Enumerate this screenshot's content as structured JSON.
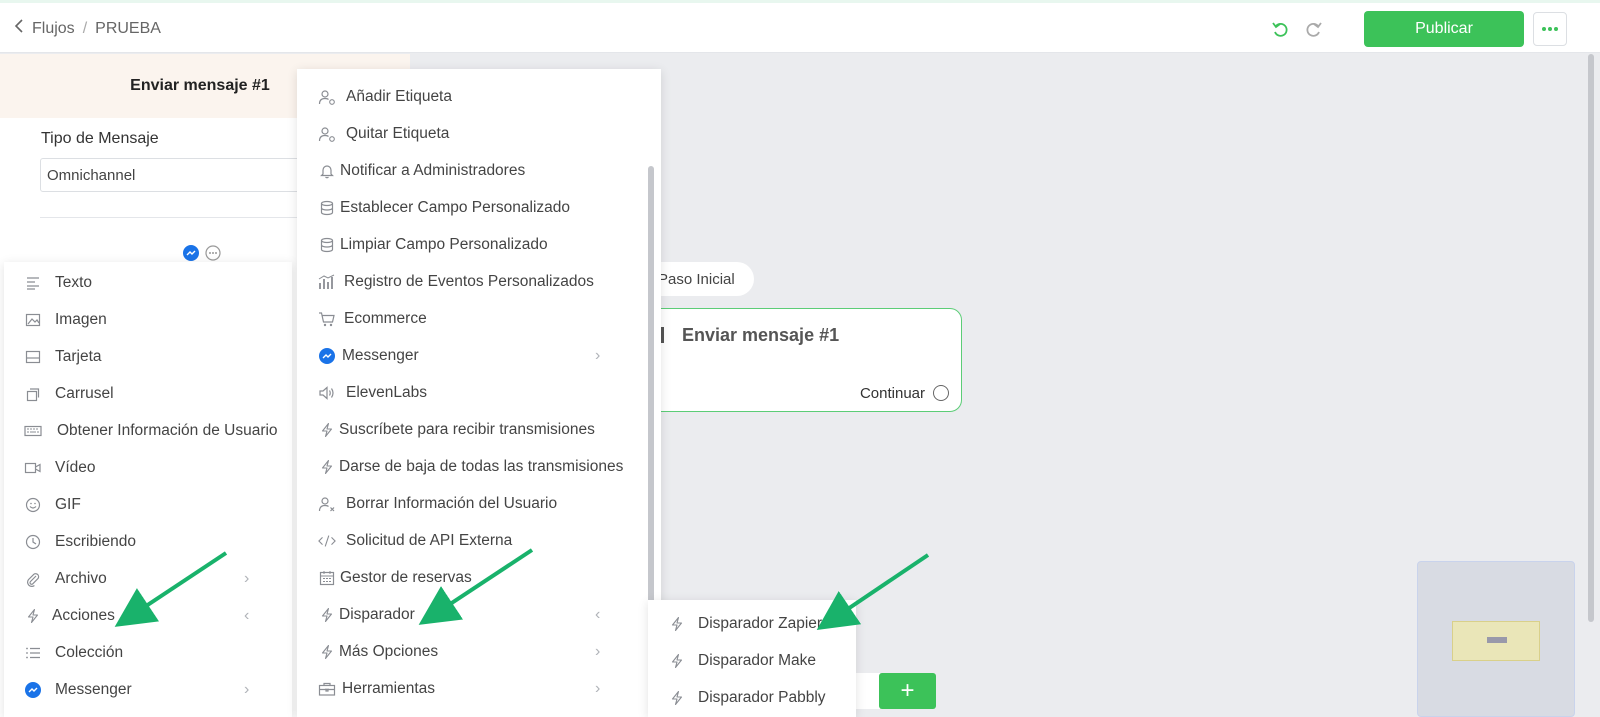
{
  "header": {
    "back_label": "Flujos",
    "separator": "/",
    "flow_name": "PRUEBA",
    "publish_label": "Publicar",
    "accent_color": "#3cc259"
  },
  "panel": {
    "title": "Enviar mensaje #1",
    "tipo_label": "Tipo de Mensaje",
    "tipo_value": "Omnichannel"
  },
  "content_menu": {
    "items": [
      {
        "label": "Texto",
        "icon": "text-lines-icon"
      },
      {
        "label": "Imagen",
        "icon": "image-icon"
      },
      {
        "label": "Tarjeta",
        "icon": "card-icon"
      },
      {
        "label": "Carrusel",
        "icon": "carousel-icon"
      },
      {
        "label": "Obtener Información de Usuario",
        "icon": "keyboard-icon"
      },
      {
        "label": "Vídeo",
        "icon": "video-icon"
      },
      {
        "label": "GIF",
        "icon": "smiley-icon"
      },
      {
        "label": "Escribiendo",
        "icon": "clock-icon"
      },
      {
        "label": "Archivo",
        "icon": "paperclip-icon"
      },
      {
        "label": "Acciones",
        "icon": "bolt-icon"
      },
      {
        "label": "Colección",
        "icon": "list-icon"
      },
      {
        "label": "Messenger",
        "icon": "messenger-icon"
      }
    ]
  },
  "actions_menu": {
    "items": [
      {
        "label": "Añadir Etiqueta",
        "icon": "user-tag-icon"
      },
      {
        "label": "Quitar Etiqueta",
        "icon": "user-tag-icon"
      },
      {
        "label": "Notificar a Administradores",
        "icon": "bell-icon"
      },
      {
        "label": "Establecer Campo Personalizado",
        "icon": "database-icon"
      },
      {
        "label": "Limpiar Campo Personalizado",
        "icon": "database-icon"
      },
      {
        "label": "Registro de Eventos Personalizados",
        "icon": "bar-chart-icon"
      },
      {
        "label": "Ecommerce",
        "icon": "cart-icon"
      },
      {
        "label": "Messenger",
        "icon": "messenger-icon"
      },
      {
        "label": "ElevenLabs",
        "icon": "speaker-icon"
      },
      {
        "label": "Suscríbete para recibir transmisiones",
        "icon": "bolt-icon"
      },
      {
        "label": "Darse de baja de todas las transmisiones",
        "icon": "bolt-icon"
      },
      {
        "label": "Borrar Información del Usuario",
        "icon": "user-x-icon"
      },
      {
        "label": "Solicitud de API Externa",
        "icon": "code-icon"
      },
      {
        "label": "Gestor de reservas",
        "icon": "calendar-icon"
      },
      {
        "label": "Disparador",
        "icon": "bolt-icon"
      },
      {
        "label": "Más Opciones",
        "icon": "bolt-icon"
      },
      {
        "label": "Herramientas",
        "icon": "toolbox-icon"
      }
    ]
  },
  "trigger_menu": {
    "items": [
      {
        "label": "Disparador Zapier",
        "icon": "bolt-icon"
      },
      {
        "label": "Disparador Make",
        "icon": "bolt-icon"
      },
      {
        "label": "Disparador Pabbly",
        "icon": "bolt-icon"
      }
    ]
  },
  "canvas": {
    "start_label": "Paso Inicial",
    "node_title": "Enviar mensaje #1",
    "node_continue": "Continuar",
    "add_symbol": "+"
  }
}
